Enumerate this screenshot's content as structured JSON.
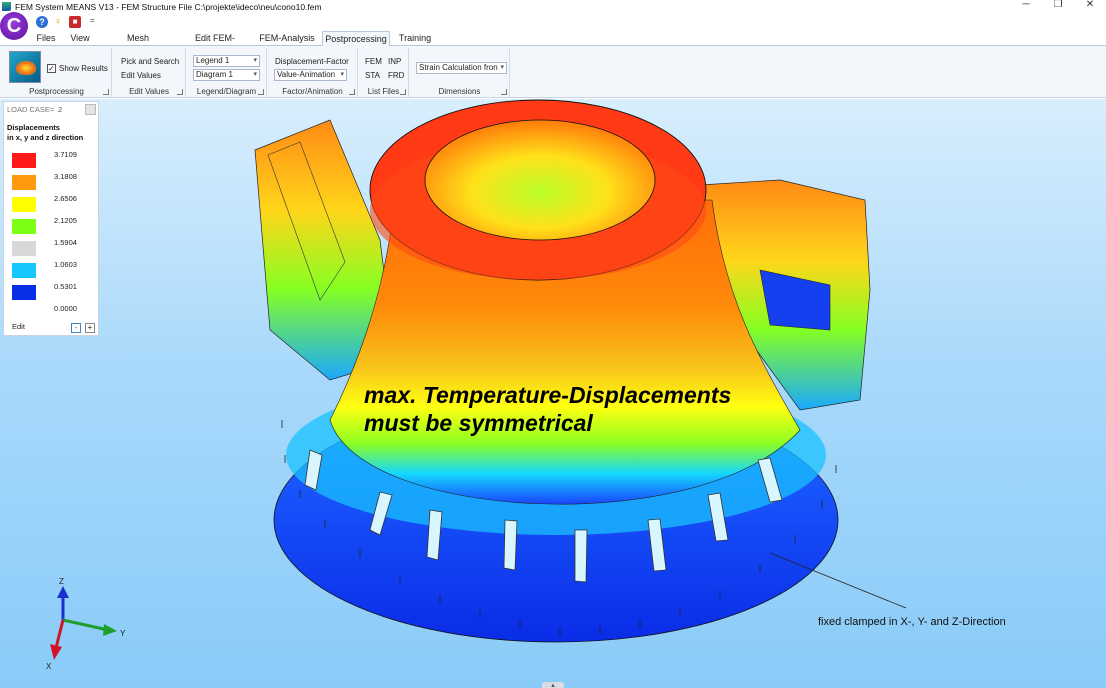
{
  "window": {
    "title": "FEM System MEANS V13 - FEM Structure File C:\\projekte\\ideco\\neu\\cono10.fem",
    "controls": [
      "─",
      "❐",
      "✕"
    ]
  },
  "logo": {
    "letter": "C"
  },
  "qat": {
    "help": "?",
    "key": "♀",
    "stop": "■",
    "more": "="
  },
  "tabs": [
    {
      "label": "Files"
    },
    {
      "label": "View"
    },
    {
      "label": "Mesh Generation"
    },
    {
      "label": "Edit FEM-Project"
    },
    {
      "label": "FEM-Analysis"
    },
    {
      "label": "Postprocessing"
    },
    {
      "label": "Training"
    }
  ],
  "active_tab": "Postprocessing",
  "ribbon": {
    "postprocessing": {
      "show_results": "Show Results",
      "show_results_checked": true,
      "caption": "Postprocessing"
    },
    "edit_values": {
      "pick_search": "Pick and Search",
      "edit_values": "Edit Values",
      "caption": "Edit Values"
    },
    "legend_diagram": {
      "legend": "Legend 1",
      "diagram": "Diagram 1",
      "caption": "Legend/Diagram"
    },
    "factor_animation": {
      "displacement_factor": "Displacement-Factor",
      "value_animation": "Value-Animation",
      "caption": "Factor/Animation"
    },
    "list_files": {
      "fem": "FEM",
      "inp": "INP",
      "sta": "STA",
      "frd": "FRD",
      "caption": "List Files"
    },
    "dimensions": {
      "strain": "Strain Calculation fron",
      "caption": "Dimensions"
    }
  },
  "legend_panel": {
    "load_case_label": "LOAD CASE=",
    "load_case": "2",
    "title_line1": "Displacements",
    "title_line2": "in x, y and z direction",
    "entries": [
      {
        "value": "3.7109",
        "color": "#ff1a1a"
      },
      {
        "value": "3.1808",
        "color": "#ff9a0f"
      },
      {
        "value": "2.6506",
        "color": "#ffff00"
      },
      {
        "value": "2.1205",
        "color": "#7dff16"
      },
      {
        "value": "1.5904",
        "color": "#d8d8d8"
      },
      {
        "value": "1.0603",
        "color": "#14c8ff"
      },
      {
        "value": "0.5301",
        "color": "#0a2ee6"
      },
      {
        "value": "0.0000",
        "color": "#ffffff"
      }
    ],
    "edit_label": "Edit",
    "minus": "-",
    "plus": "+"
  },
  "annotation": {
    "line1": "max. Temperature-Displacements",
    "line2": "must be symmetrical",
    "fixed_note": "fixed clamped in X-, Y- and Z-Direction"
  },
  "axes": {
    "z": "Z",
    "y": "Y",
    "x": "X"
  },
  "colors": {
    "ribbon_bg": "#f3f6fa",
    "viewport_top": "#d8eefc",
    "viewport_bottom": "#89cbf8"
  }
}
